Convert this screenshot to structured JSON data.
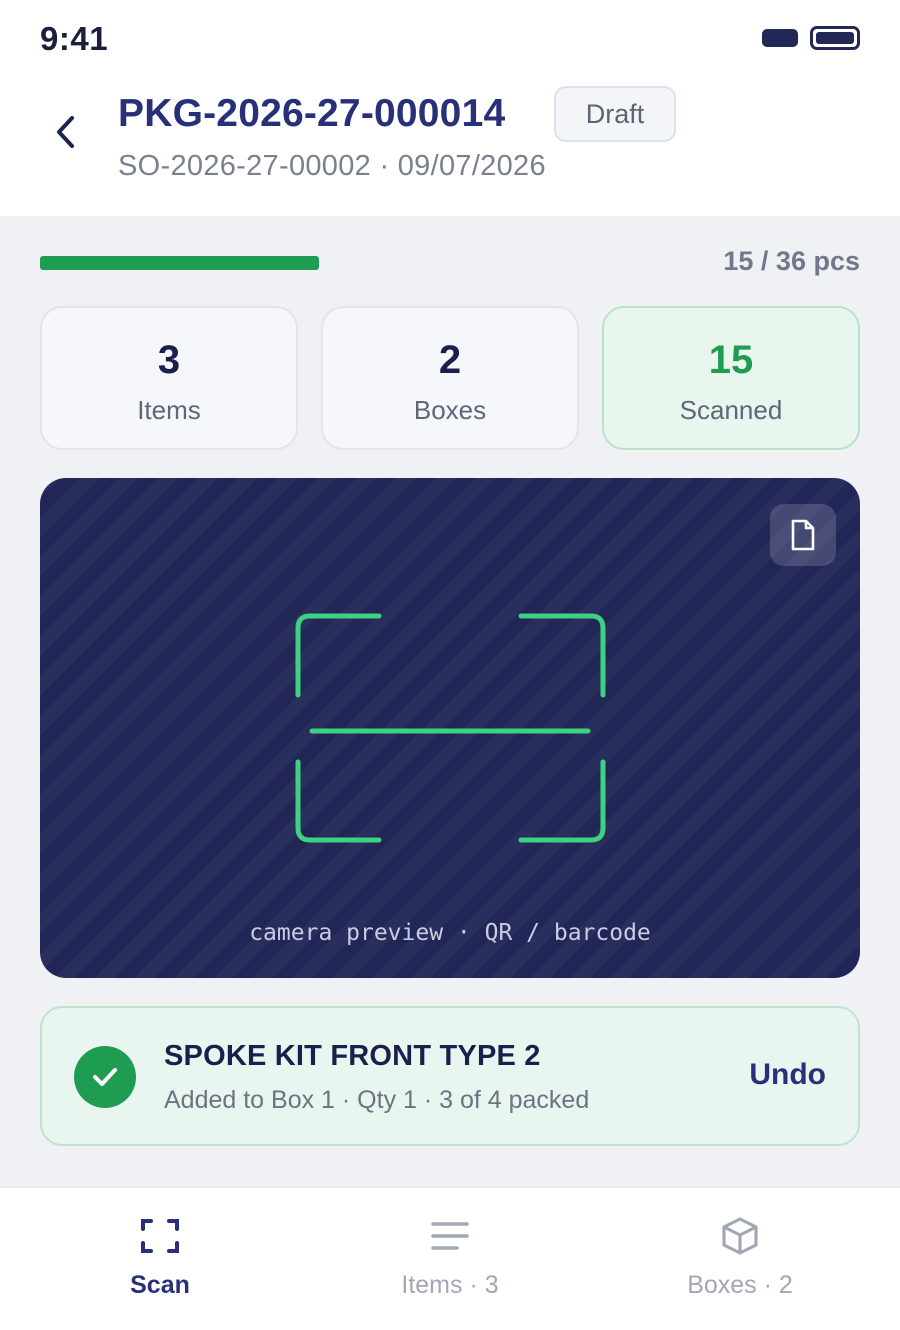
{
  "status_bar": {
    "time": "9:41"
  },
  "header": {
    "title": "PKG-2026-27-000014",
    "status_badge": "Draft",
    "subtitle": "SO-2026-27-00002 · 09/07/2026"
  },
  "progress": {
    "label": "15 / 36 pcs",
    "scanned": 15,
    "total": 36,
    "color": "#1e9c52"
  },
  "stats": [
    {
      "value": "3",
      "label": "Items"
    },
    {
      "value": "2",
      "label": "Boxes"
    },
    {
      "value": "15",
      "label": "Scanned"
    }
  ],
  "camera": {
    "caption": "camera preview · QR / barcode",
    "doc_icon": "document-icon",
    "frame_color": "#3ed17f"
  },
  "toast": {
    "title": "SPOKE KIT FRONT TYPE 2",
    "detail": "Added to Box 1 · Qty 1 · 3 of 4 packed",
    "action": "Undo",
    "icon": "check-circle-icon"
  },
  "bottom_nav": [
    {
      "label": "Scan",
      "icon": "scan-icon",
      "active": true
    },
    {
      "label": "Items · 3",
      "icon": "list-icon",
      "active": false
    },
    {
      "label": "Boxes · 2",
      "icon": "box-icon",
      "active": false
    }
  ],
  "colors": {
    "brand": "#28307a",
    "success": "#1e9c52",
    "camera_bg": "#212657"
  }
}
